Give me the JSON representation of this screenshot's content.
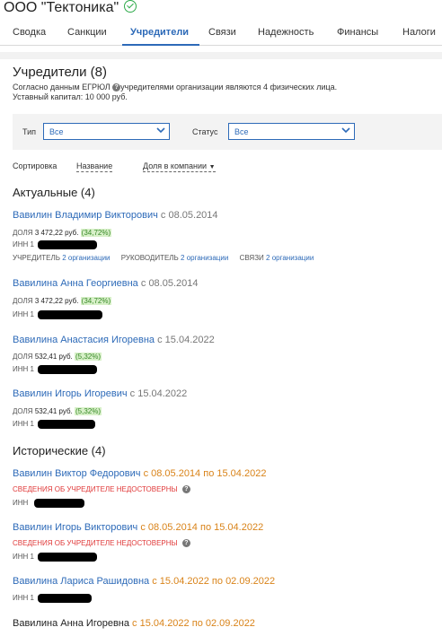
{
  "company": {
    "name": "ООО \"Тектоника\""
  },
  "tabs": [
    {
      "label": "Сводка"
    },
    {
      "label": "Санкции"
    },
    {
      "label": "Учредители"
    },
    {
      "label": "Связи"
    },
    {
      "label": "Надежность"
    },
    {
      "label": "Финансы"
    },
    {
      "label": "Налоги"
    }
  ],
  "section": {
    "title": "Учредители (8)",
    "desc_prefix": "Согласно данным ЕГРЮЛ",
    "desc_suffix": "учредителями организации являются 4 физических лица.",
    "capital": "Уставный капитал: 10 000 руб."
  },
  "filters": {
    "type_label": "Тип",
    "type_value": "Все",
    "status_label": "Статус",
    "status_value": "Все"
  },
  "sort": {
    "label": "Сортировка",
    "by_name": "Название",
    "by_share": "Доля в компании"
  },
  "labels": {
    "share": "ДОЛЯ",
    "inn": "ИНН",
    "inn_prefix": "1",
    "founder": "УЧРЕДИТЕЛЬ",
    "manager": "РУКОВОДИТЕЛЬ",
    "links": "СВЯЗИ",
    "two_orgs": "2 организации",
    "unreliable": "СВЕДЕНИЯ ОБ УЧРЕДИТЕЛЕ НЕДОСТОВЕРНЫ",
    "since": "с",
    "until": "по"
  },
  "actual": {
    "title": "Актуальные (4)",
    "people": [
      {
        "name": "Вавилин Владимир Викторович",
        "since": "08.05.2014",
        "share": "3 472,22 руб.",
        "pct": "(34,72%)"
      },
      {
        "name": "Вавилина Анна Георгиевна",
        "since": "08.05.2014",
        "share": "3 472,22 руб.",
        "pct": "(34,72%)"
      },
      {
        "name": "Вавилина Анастасия Игоревна",
        "since": "15.04.2022",
        "share": "532,41 руб.",
        "pct": "(5,32%)"
      },
      {
        "name": "Вавилин Игорь Игоревич",
        "since": "15.04.2022",
        "share": "532,41 руб.",
        "pct": "(5,32%)"
      }
    ]
  },
  "historical": {
    "title": "Исторические (4)",
    "people": [
      {
        "name": "Вавилин Виктор Федорович",
        "from": "08.05.2014",
        "to": "15.04.2022"
      },
      {
        "name": "Вавилин Игорь Викторович",
        "from": "08.05.2014",
        "to": "15.04.2022"
      },
      {
        "name": "Вавилина Лариса Рашидовна",
        "from": "15.04.2022",
        "to": "02.09.2022"
      },
      {
        "name": "Вавилина Анна Игоревна",
        "from": "15.04.2022",
        "to": "02.09.2022"
      }
    ]
  },
  "colors": {
    "accent": "#2d6ab8",
    "warning": "#e03a3a",
    "date_range": "#d98319",
    "success": "#2eaa4a"
  }
}
